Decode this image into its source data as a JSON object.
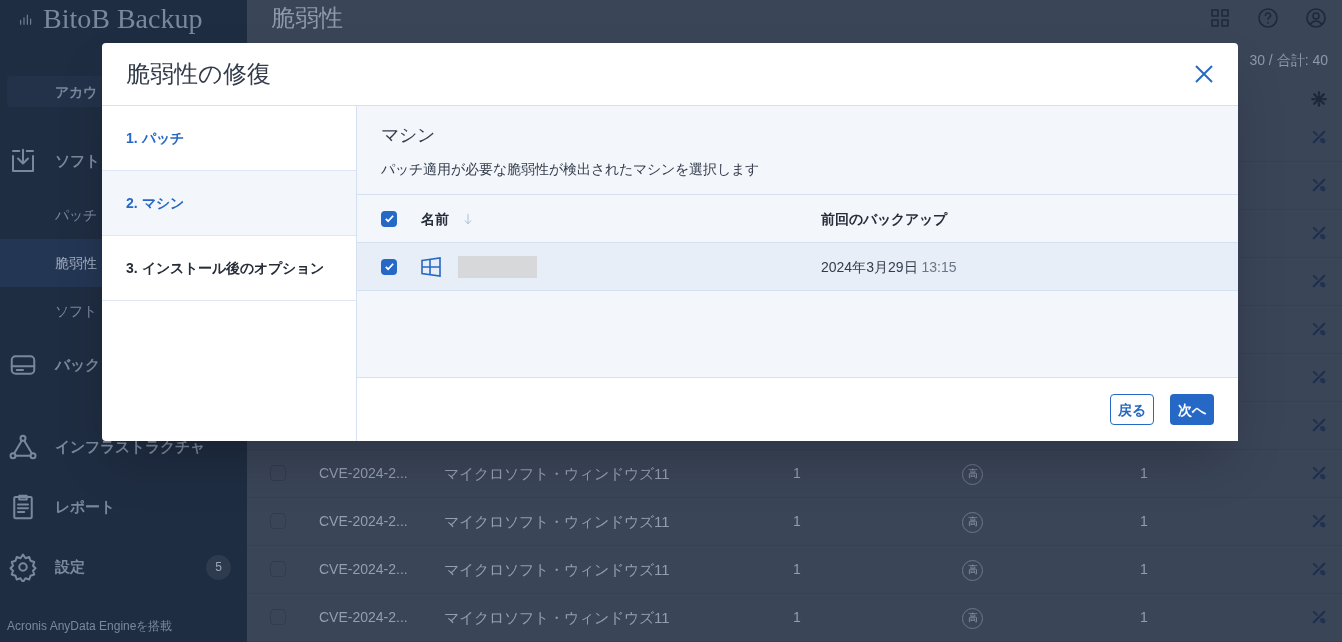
{
  "app": {
    "logo": "BitoB Backup"
  },
  "sidebar": {
    "account_button": "アカウ",
    "groups": [
      {
        "label": "ソフト",
        "children": [
          {
            "label": "パッチ",
            "selected": false
          },
          {
            "label": "脆弱性",
            "selected": true
          },
          {
            "label": "ソフト",
            "selected": false
          }
        ]
      },
      {
        "label": "バック"
      },
      {
        "label": "インフラストラクチャ"
      },
      {
        "label": "レポート"
      },
      {
        "label": "設定",
        "badge": "5"
      }
    ],
    "footer": "Acronis AnyData Engineを搭載"
  },
  "page": {
    "title": "脆弱性",
    "counter": "30 / 合計: 40",
    "rows": [
      {
        "kind": "covered"
      },
      {
        "kind": "covered"
      },
      {
        "kind": "covered"
      },
      {
        "kind": "covered"
      },
      {
        "kind": "covered"
      },
      {
        "kind": "covered"
      },
      {
        "kind": "covered"
      },
      {
        "kind": "full",
        "checked": false,
        "id": "CVE-2024-2...",
        "product": "マイクロソフト・ウィンドウズ11",
        "count": "1",
        "severity": "高",
        "machines": "1"
      },
      {
        "kind": "full",
        "checked": false,
        "id": "CVE-2024-2...",
        "product": "マイクロソフト・ウィンドウズ11",
        "count": "1",
        "severity": "高",
        "machines": "1"
      },
      {
        "kind": "full",
        "checked": false,
        "id": "CVE-2024-2...",
        "product": "マイクロソフト・ウィンドウズ11",
        "count": "1",
        "severity": "高",
        "machines": "1"
      },
      {
        "kind": "full",
        "checked": false,
        "id": "CVE-2024-2...",
        "product": "マイクロソフト・ウィンドウズ11",
        "count": "1",
        "severity": "高",
        "machines": "1"
      }
    ]
  },
  "dialog": {
    "title": "脆弱性の修復",
    "steps": [
      {
        "label": "1. パッチ",
        "completed": true,
        "selected": false
      },
      {
        "label": "2. マシン",
        "completed": false,
        "selected": true
      },
      {
        "label": "3. インストール後のオプション",
        "completed": false,
        "selected": false
      }
    ],
    "heading": "マシン",
    "description": "パッチ適用が必要な脆弱性が検出されたマシンを選択します",
    "select_all": {
      "checked": true
    },
    "columns": [
      {
        "label": "名前",
        "sorted": true
      },
      {
        "label": "前回のバックアップ",
        "sorted": false
      }
    ],
    "rows": [
      {
        "checked": true,
        "selected": true,
        "date": "2024年3月29日",
        "time": "13:15"
      }
    ],
    "buttons": {
      "back": "戻る",
      "next": "次へ"
    }
  }
}
